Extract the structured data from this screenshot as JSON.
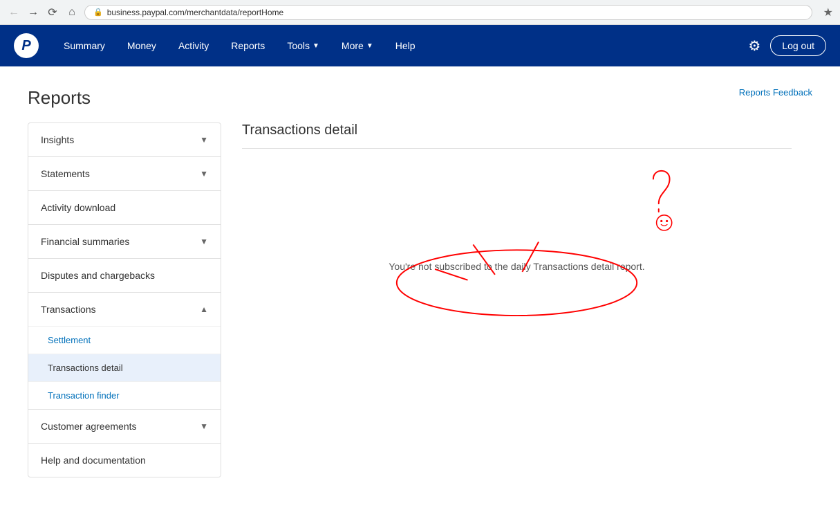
{
  "browser": {
    "url": "business.paypal.com/merchantdata/reportHome",
    "back_disabled": true
  },
  "nav": {
    "logo": "P",
    "items": [
      {
        "label": "Summary",
        "has_dropdown": false
      },
      {
        "label": "Money",
        "has_dropdown": false
      },
      {
        "label": "Activity",
        "has_dropdown": false
      },
      {
        "label": "Reports",
        "has_dropdown": false
      },
      {
        "label": "Tools",
        "has_dropdown": true
      },
      {
        "label": "More",
        "has_dropdown": true
      },
      {
        "label": "Help",
        "has_dropdown": false
      }
    ],
    "logout_label": "Log out"
  },
  "page": {
    "title": "Reports",
    "feedback_label": "Reports Feedback"
  },
  "sidebar": {
    "sections": [
      {
        "label": "Insights",
        "type": "collapsible",
        "expanded": false,
        "children": []
      },
      {
        "label": "Statements",
        "type": "collapsible",
        "expanded": false,
        "children": []
      },
      {
        "label": "Activity download",
        "type": "simple"
      },
      {
        "label": "Financial summaries",
        "type": "collapsible",
        "expanded": false,
        "children": []
      },
      {
        "label": "Disputes and chargebacks",
        "type": "simple"
      },
      {
        "label": "Transactions",
        "type": "collapsible",
        "expanded": true,
        "children": [
          {
            "label": "Settlement",
            "active": false
          },
          {
            "label": "Transactions detail",
            "active": true
          },
          {
            "label": "Transaction finder",
            "active": false
          }
        ]
      },
      {
        "label": "Customer agreements",
        "type": "collapsible",
        "expanded": false,
        "children": []
      },
      {
        "label": "Help and documentation",
        "type": "simple"
      }
    ]
  },
  "main": {
    "section_title": "Transactions detail",
    "empty_message": "You're not subscribed to the daily Transactions detail report."
  }
}
